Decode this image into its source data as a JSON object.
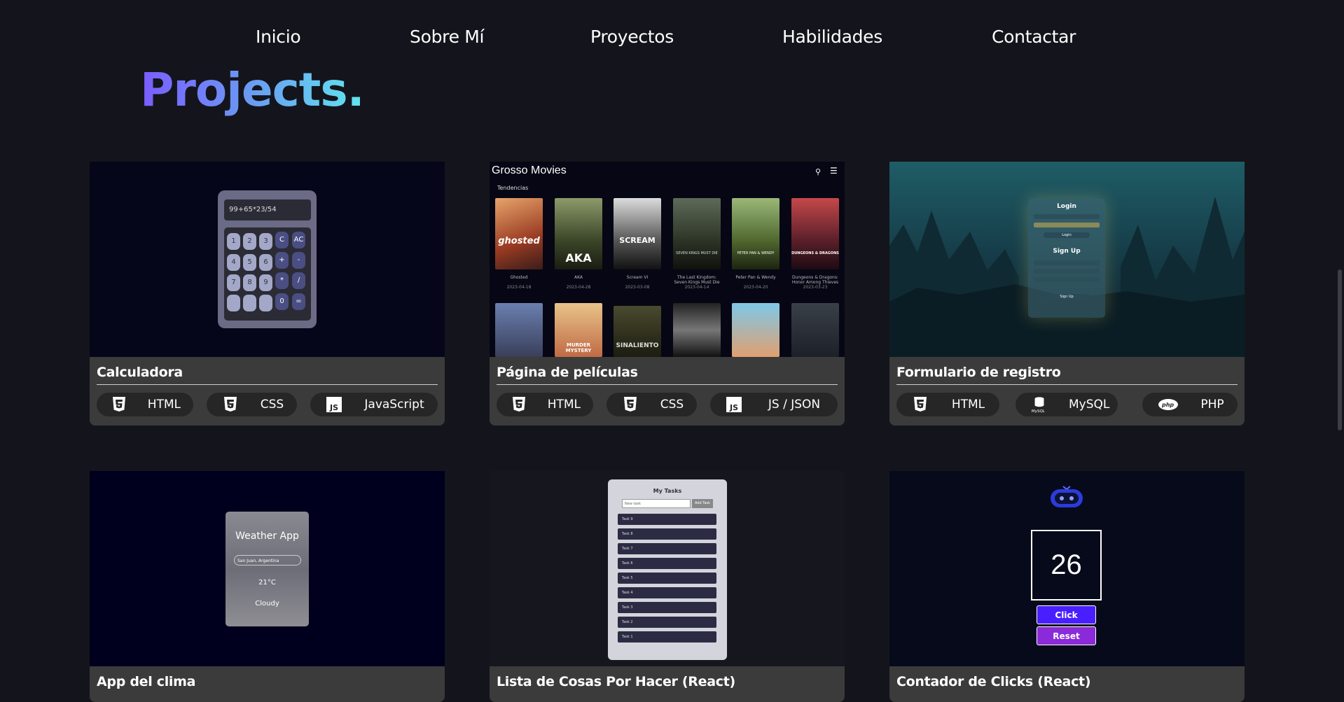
{
  "nav": {
    "items": [
      {
        "label": "Inicio"
      },
      {
        "label": "Sobre Mí"
      },
      {
        "label": "Proyectos"
      },
      {
        "label": "Habilidades"
      },
      {
        "label": "Contactar"
      }
    ]
  },
  "section_title": "Projects.",
  "projects": [
    {
      "title": "Calculadora",
      "tags": [
        "HTML",
        "CSS",
        "JavaScript"
      ],
      "preview": {
        "display": "99+65*23/54",
        "keys": [
          "1",
          "2",
          "3",
          "C",
          "AC",
          "4",
          "5",
          "6",
          "+",
          "-",
          "7",
          "8",
          "9",
          "*",
          "/",
          "0",
          "="
        ]
      }
    },
    {
      "title": "Página de películas",
      "tags": [
        "HTML",
        "CSS",
        "JS / JSON"
      ],
      "preview": {
        "site_name": "Grosso Movies",
        "section": "Tendencias",
        "movies": [
          {
            "title": "Ghosted",
            "date": "2023-04-18",
            "tagline": "ghosted"
          },
          {
            "title": "AKA",
            "date": "2023-04-28",
            "tagline": "AKA"
          },
          {
            "title": "Scream VI",
            "date": "2023-03-08",
            "tagline": "SCREAM"
          },
          {
            "title": "The Last Kingdom: Seven Kings Must Die",
            "date": "2023-04-14",
            "tagline": "SEVEN KINGS MUST DIE"
          },
          {
            "title": "Peter Pan & Wendy",
            "date": "2023-04-20",
            "tagline": "PETER PAN & WENDY"
          },
          {
            "title": "Dungeons & Dragons: Honor Among Thieves",
            "date": "2023-03-23",
            "tagline": "DUNGEONS & DRAGONS"
          }
        ],
        "row2_taglines": [
          "",
          "MURDER MYSTERY",
          "SINALIENTO",
          "",
          "",
          ""
        ]
      }
    },
    {
      "title": "Formulario de registro",
      "tags": [
        "HTML",
        "MySQL",
        "PHP"
      ],
      "preview": {
        "login_title": "Login",
        "signup_title": "Sign Up",
        "login_button": "Login",
        "signup_button": "Sign Up"
      }
    },
    {
      "title": "App del clima",
      "tags": [],
      "preview": {
        "app_title": "Weather App",
        "location": "San Juan, Argentina",
        "temperature": "21°C",
        "condition": "Cloudy"
      }
    },
    {
      "title": "Lista de Cosas Por Hacer (React)",
      "tags": [],
      "preview": {
        "heading": "My Tasks",
        "input_placeholder": "New task",
        "add_button": "Add Task",
        "tasks": [
          "Task 9",
          "Task 8",
          "Task 7",
          "Task 6",
          "Task 5",
          "Task 4",
          "Task 3",
          "Task 2",
          "Task 1"
        ]
      }
    },
    {
      "title": "Contador de Clicks (React)",
      "tags": [],
      "preview": {
        "count": "26",
        "click_button": "Click",
        "reset_button": "Reset"
      }
    }
  ],
  "colors": {
    "background": "#14141c",
    "card": "#3b3b3b",
    "badge": "#262626",
    "title_gradient": [
      "#7a5cff",
      "#61e6ee"
    ],
    "click_button": "#4a1fff",
    "reset_button": "#8a2ad8"
  },
  "icons": {
    "html": "html5-icon",
    "css": "css3-icon",
    "js": "javascript-icon",
    "mysql": "mysql-icon",
    "php": "php-icon"
  }
}
